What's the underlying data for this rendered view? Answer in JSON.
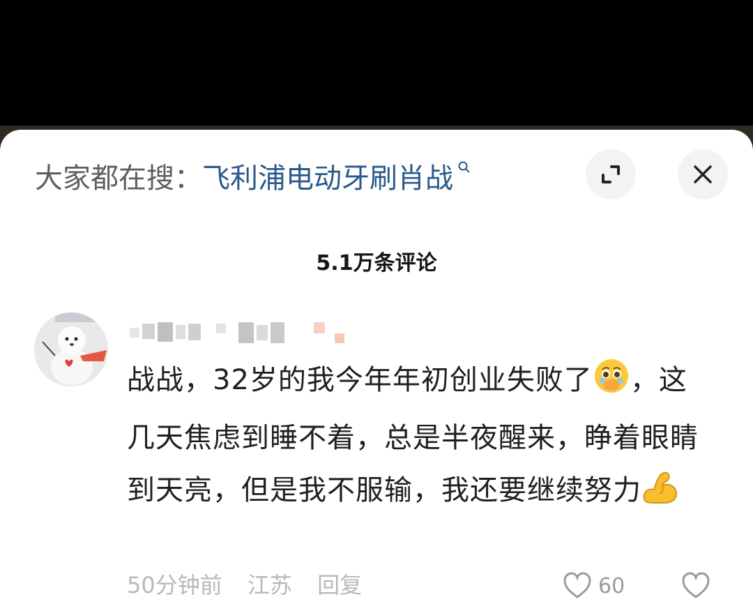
{
  "sheet": {
    "search_prefix": "大家都在搜：",
    "search_term": "飞利浦电动牙刷肖战",
    "comment_count": "5.1万条评论"
  },
  "comment": {
    "text_part1": "战战，32岁的我今年年初创业失败了",
    "emoji1": "pleading-face-emoji",
    "text_part2": "，这几天焦虑到睡不着，总是半夜醒来，睁着眼睛到天亮，但是我不服输，我还要继续努力",
    "emoji2": "flexed-biceps-emoji",
    "meta_time": "50分钟前",
    "meta_location": "江苏",
    "meta_reply": "回复",
    "like_count": "60"
  },
  "colors": {
    "search_term": "#2a5a8a",
    "label": "#5e5e5e",
    "button_bg": "#f3f3f3"
  }
}
